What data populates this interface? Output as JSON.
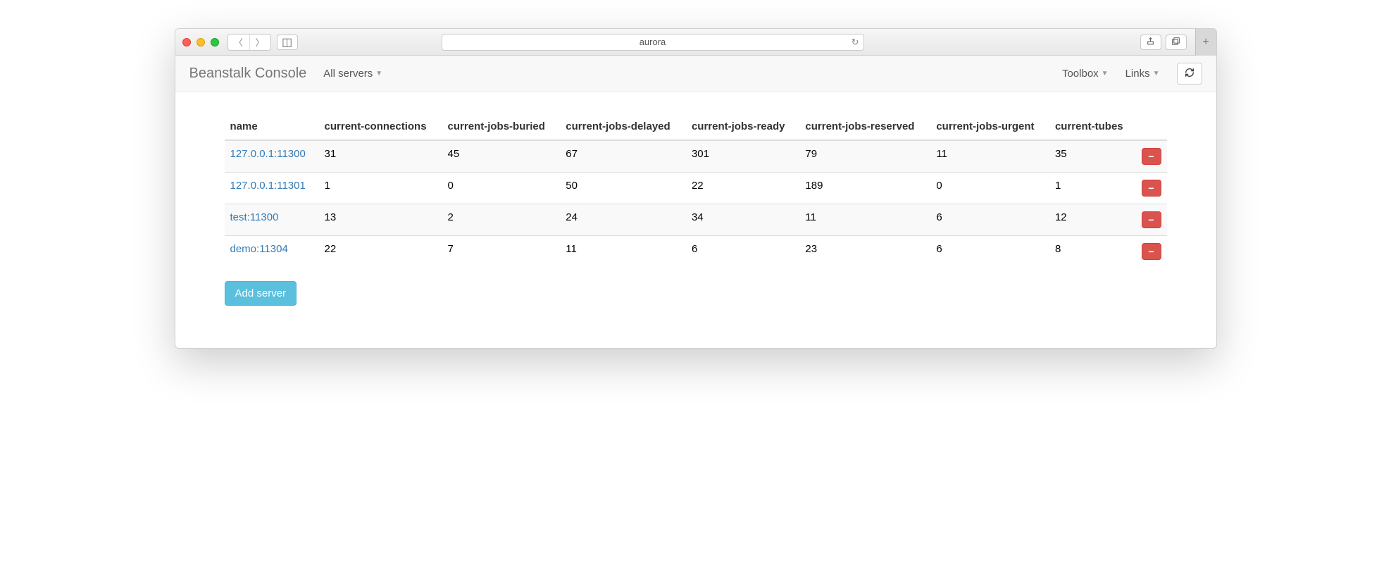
{
  "titlebar": {
    "url_label": "aurora"
  },
  "navbar": {
    "brand": "Beanstalk Console",
    "servers_label": "All servers",
    "toolbox_label": "Toolbox",
    "links_label": "Links"
  },
  "table": {
    "headers": {
      "name": "name",
      "connections": "current-connections",
      "buried": "current-jobs-buried",
      "delayed": "current-jobs-delayed",
      "ready": "current-jobs-ready",
      "reserved": "current-jobs-reserved",
      "urgent": "current-jobs-urgent",
      "tubes": "current-tubes"
    },
    "rows": [
      {
        "name": "127.0.0.1:11300",
        "connections": "31",
        "buried": "45",
        "delayed": "67",
        "ready": "301",
        "reserved": "79",
        "urgent": "11",
        "tubes": "35"
      },
      {
        "name": "127.0.0.1:11301",
        "connections": "1",
        "buried": "0",
        "delayed": "50",
        "ready": "22",
        "reserved": "189",
        "urgent": "0",
        "tubes": "1"
      },
      {
        "name": "test:11300",
        "connections": "13",
        "buried": "2",
        "delayed": "24",
        "ready": "34",
        "reserved": "11",
        "urgent": "6",
        "tubes": "12"
      },
      {
        "name": "demo:11304",
        "connections": "22",
        "buried": "7",
        "delayed": "11",
        "ready": "6",
        "reserved": "23",
        "urgent": "6",
        "tubes": "8"
      }
    ]
  },
  "buttons": {
    "add_server": "Add server",
    "delete": "−"
  }
}
